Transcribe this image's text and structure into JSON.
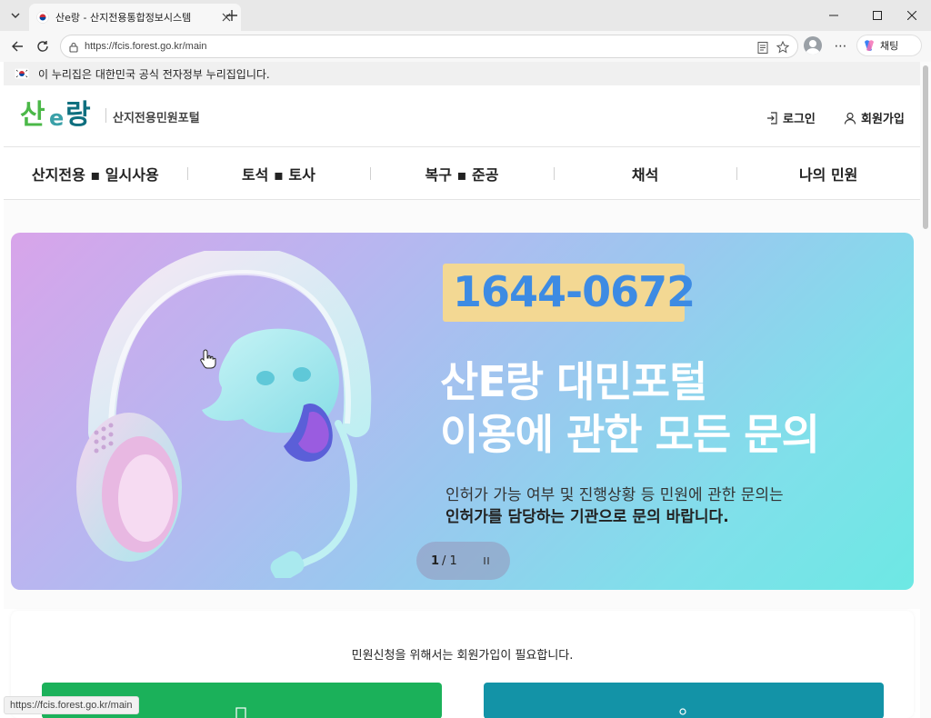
{
  "browser": {
    "tab_title": "산e랑 - 산지전용통합정보시스템",
    "url": "https://fcis.forest.go.kr/main",
    "copilot_label": "채팅",
    "status_url": "https://fcis.forest.go.kr/main"
  },
  "gov_banner": {
    "text": "이 누리집은 대한민국 공식 전자정부 누리집입니다."
  },
  "header": {
    "logo_text": "산e랑",
    "subtitle": "산지전용민원포털",
    "login_label": "로그인",
    "signup_label": "회원가입"
  },
  "nav": {
    "items": [
      {
        "label": "산지전용 ▪ 일시사용"
      },
      {
        "label": "토석 ▪ 토사"
      },
      {
        "label": "복구 ▪ 준공"
      },
      {
        "label": "채석"
      },
      {
        "label": "나의 민원"
      }
    ]
  },
  "banner": {
    "phone": "1644-0672",
    "headline1": "산E랑 대민포털",
    "headline2": "이용에 관한 모든 문의",
    "desc1": "인허가 가능 여부 및 진행상황 등 민원에 관한 문의는",
    "desc2": "인허가를 담당하는 기관으로 문의 바랍니다.",
    "pager_current": "1",
    "pager_total": "/ 1"
  },
  "signup_card": {
    "notice": "민원신청을 위해서는 회원가입이 필요합니다."
  },
  "colors": {
    "phone_text": "#3d8be3",
    "phone_box": "#f3d893",
    "green_button": "#1bb15a",
    "teal_button": "#1393a7",
    "logo_green": "#4bb848",
    "logo_teal": "#0f6f7f"
  }
}
